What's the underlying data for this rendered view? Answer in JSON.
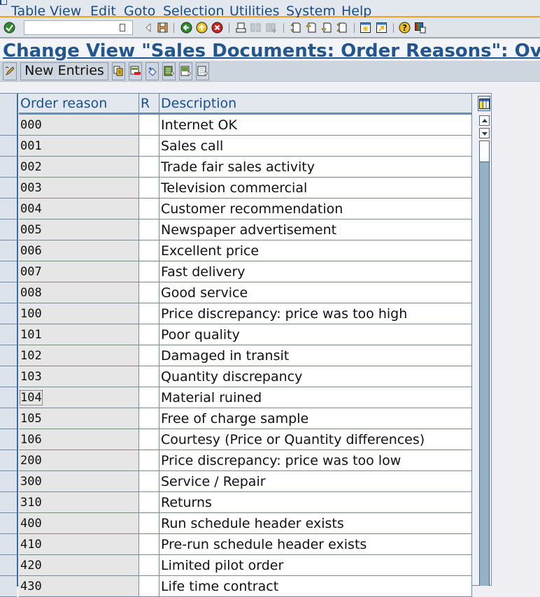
{
  "menubar": {
    "items": [
      "Table View",
      "Edit",
      "Goto",
      "Selection",
      "Utilities",
      "System",
      "Help"
    ]
  },
  "system_toolbar": {
    "command_field_value": "",
    "icons": [
      "enter-icon",
      "back-nav-icon",
      "save-icon",
      "back-icon",
      "exit-icon",
      "cancel-icon",
      "print-icon",
      "find-icon",
      "find-next-icon",
      "first-page-icon",
      "previous-page-icon",
      "next-page-icon",
      "last-page-icon",
      "new-session-icon",
      "create-shortcut-icon",
      "help-icon",
      "customize-layout-icon"
    ]
  },
  "title": "Change View \"Sales Documents: Order Reasons\": Overview",
  "app_toolbar": {
    "new_entries_label": "New Entries",
    "icons": [
      "display-change-icon",
      "copy-as-icon",
      "delete-icon",
      "undo-change-icon",
      "select-all-icon",
      "select-block-icon",
      "deselect-all-icon"
    ]
  },
  "table": {
    "columns": [
      "Order reason",
      "R",
      "Description"
    ],
    "rows": [
      {
        "key": "000",
        "r": "",
        "desc": "Internet OK"
      },
      {
        "key": "001",
        "r": "",
        "desc": "Sales call"
      },
      {
        "key": "002",
        "r": "",
        "desc": "Trade fair sales activity"
      },
      {
        "key": "003",
        "r": "",
        "desc": "Television commercial"
      },
      {
        "key": "004",
        "r": "",
        "desc": "Customer recommendation"
      },
      {
        "key": "005",
        "r": "",
        "desc": "Newspaper advertisement"
      },
      {
        "key": "006",
        "r": "",
        "desc": "Excellent price"
      },
      {
        "key": "007",
        "r": "",
        "desc": "Fast delivery"
      },
      {
        "key": "008",
        "r": "",
        "desc": "Good service"
      },
      {
        "key": "100",
        "r": "",
        "desc": "Price discrepancy: price was too high"
      },
      {
        "key": "101",
        "r": "",
        "desc": "Poor quality"
      },
      {
        "key": "102",
        "r": "",
        "desc": "Damaged in transit"
      },
      {
        "key": "103",
        "r": "",
        "desc": "Quantity discrepancy"
      },
      {
        "key": "104",
        "r": "",
        "desc": "Material ruined",
        "focused": true
      },
      {
        "key": "105",
        "r": "",
        "desc": "Free of charge sample"
      },
      {
        "key": "106",
        "r": "",
        "desc": "Courtesy (Price or Quantity differences)"
      },
      {
        "key": "200",
        "r": "",
        "desc": "Price discrepancy: price was too low"
      },
      {
        "key": "300",
        "r": "",
        "desc": "Service / Repair"
      },
      {
        "key": "310",
        "r": "",
        "desc": "Returns"
      },
      {
        "key": "400",
        "r": "",
        "desc": "Run schedule header exists"
      },
      {
        "key": "410",
        "r": "",
        "desc": "Pre-run schedule header exists"
      },
      {
        "key": "420",
        "r": "",
        "desc": "Limited pilot order"
      },
      {
        "key": "430",
        "r": "",
        "desc": "Life time contract"
      }
    ]
  },
  "colors": {
    "accent_orange": "#f0a020",
    "title_blue": "#23568e",
    "menu_blue": "#1a4a8a",
    "grid_line": "#6a8cb0"
  }
}
